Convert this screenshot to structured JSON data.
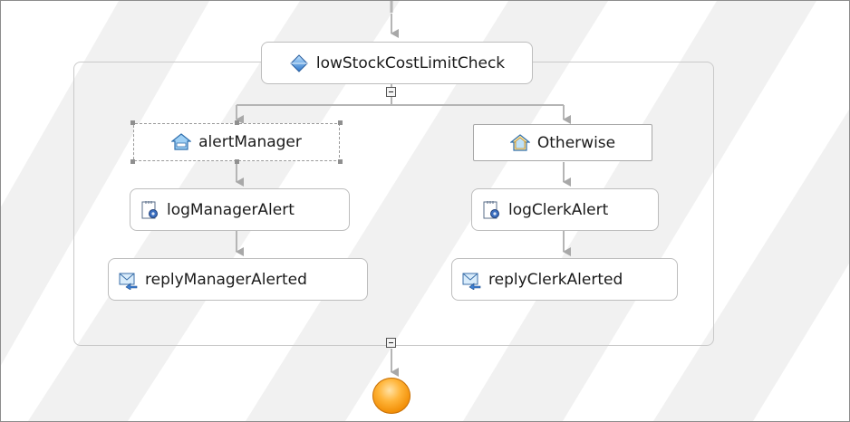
{
  "colors": {
    "connector": "#b5b5b5",
    "arrow": "#a0a0a0",
    "end_node": "#f59a16"
  },
  "process": {
    "choice": {
      "label": "lowStockCostLimitCheck",
      "icon": "choice-diamond-icon"
    },
    "branches": [
      {
        "case": {
          "label": "alertManager",
          "icon": "case-house-icon"
        },
        "activities": [
          {
            "label": "logManagerAlert",
            "icon": "snippet-gear-icon"
          },
          {
            "label": "replyManagerAlerted",
            "icon": "reply-envelope-icon"
          }
        ]
      },
      {
        "case": {
          "label": "Otherwise",
          "icon": "otherwise-house-icon"
        },
        "activities": [
          {
            "label": "logClerkAlert",
            "icon": "snippet-gear-icon"
          },
          {
            "label": "replyClerkAlerted",
            "icon": "reply-envelope-icon"
          }
        ]
      }
    ],
    "end_icon": "end-event-icon"
  }
}
